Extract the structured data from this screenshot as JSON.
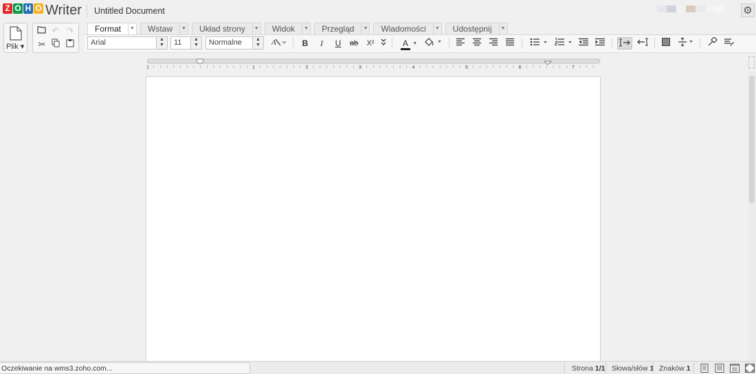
{
  "app": {
    "brand_letters": [
      "Z",
      "O",
      "H",
      "O"
    ],
    "brand_colors": [
      "#e42527",
      "#089949",
      "#226db4",
      "#f9b21d"
    ],
    "name": "Writer",
    "document_title": "Untitled Document"
  },
  "file_menu": {
    "label": "Plik ▾"
  },
  "tabs": [
    {
      "label": "Format",
      "active": true
    },
    {
      "label": "Wstaw"
    },
    {
      "label": "Układ strony"
    },
    {
      "label": "Widok"
    },
    {
      "label": "Przegląd"
    },
    {
      "label": "Wiadomości"
    },
    {
      "label": "Udostępnij"
    }
  ],
  "toolbar": {
    "font_family": "Arial",
    "font_size": "11",
    "style": "Normalne",
    "bold": "B",
    "italic": "I",
    "underline": "U",
    "strike": "ab",
    "superscript": "X²",
    "font_color_letter": "A",
    "font_color": "#222222",
    "highlight_color": "#ffff00"
  },
  "ruler": {
    "numbers": [
      "1",
      "1",
      "2",
      "3",
      "4",
      "5",
      "6",
      "7"
    ]
  },
  "status": {
    "loading_text": "Oczekiwanie na wms3.zoho.com...",
    "page_label": "Strona",
    "page_value": "1/1",
    "words_label": "Słowa/słów",
    "words_value": "1",
    "chars_label": "Znaków",
    "chars_value": "1"
  }
}
